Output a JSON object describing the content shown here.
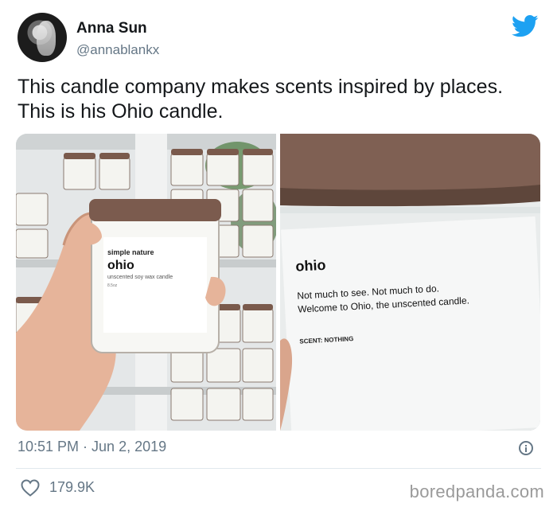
{
  "user": {
    "name": "Anna Sun",
    "handle": "@annablankx"
  },
  "tweet": {
    "text": "This candle company makes scents inspired by places. This is his Ohio candle.",
    "timestamp": "10:51 PM · Jun 2, 2019",
    "likes": "179.9K"
  },
  "left_photo": {
    "brand": "simple nature",
    "product": "ohio",
    "subtitle": "unscented soy wax candle",
    "weight": "8.5oz"
  },
  "right_photo": {
    "product": "ohio",
    "line1": "Not much to see. Not much to do.",
    "line2": "Welcome to Ohio, the unscented candle.",
    "scent": "SCENT: NOTHING"
  },
  "watermark": "boredpanda.com",
  "colors": {
    "twitter_blue": "#1da1f2",
    "secondary_text": "#657786",
    "primary_text": "#14171a"
  },
  "icons": [
    "twitter-bird-icon",
    "info-icon",
    "heart-icon"
  ]
}
